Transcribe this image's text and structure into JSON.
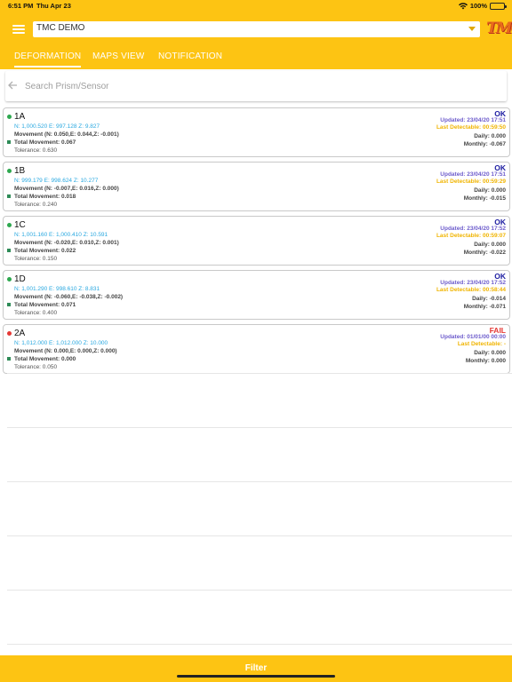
{
  "statusbar": {
    "time": "6:51 PM",
    "date": "Thu Apr 23",
    "battery": "100%"
  },
  "project": {
    "selected": "TMC DEMO"
  },
  "logo_text": "TMC",
  "tabs": [
    "DEFORMATION",
    "MAPS VIEW",
    "NOTIFICATION"
  ],
  "search": {
    "placeholder": "Search Prism/Sensor"
  },
  "items": [
    {
      "name": "1A",
      "coords": "N: 1,000.520 E: 997.128 Z: 9.827",
      "movement": "Movement (N: 0.050,E: 0.044,Z: -0.001)",
      "total": "Total Movement: 0.067",
      "tolerance": "Tolerance: 0.630",
      "status": "OK",
      "updated": "Updated: 23/04/20 17:51",
      "last_detectable": "Last Detectable: 00:59:50",
      "daily": "Daily: 0.000",
      "monthly": "Monthly: -0.067",
      "dot_color": "#2ea84f",
      "status_color": "#1a1aa0"
    },
    {
      "name": "1B",
      "coords": "N: 999.179 E: 998.624 Z: 10.277",
      "movement": "Movement (N: -0.007,E: 0.016,Z: 0.000)",
      "total": "Total Movement: 0.018",
      "tolerance": "Tolerance: 0.240",
      "status": "OK",
      "updated": "Updated: 23/04/20 17:51",
      "last_detectable": "Last Detectable: 00:59:29",
      "daily": "Daily: 0.000",
      "monthly": "Monthly: -0.015",
      "dot_color": "#2ea84f",
      "status_color": "#1a1aa0"
    },
    {
      "name": "1C",
      "coords": "N: 1,001.160 E: 1,000.410 Z: 10.591",
      "movement": "Movement (N: -0.020,E: 0.010,Z: 0.001)",
      "total": "Total Movement: 0.022",
      "tolerance": "Tolerance: 0.150",
      "status": "OK",
      "updated": "Updated: 23/04/20 17:52",
      "last_detectable": "Last Detectable: 00:59:07",
      "daily": "Daily: 0.000",
      "monthly": "Monthly: -0.022",
      "dot_color": "#2ea84f",
      "status_color": "#1a1aa0"
    },
    {
      "name": "1D",
      "coords": "N: 1,001.290 E: 998.610 Z: 8.831",
      "movement": "Movement (N: -0.060,E: -0.038,Z: -0.002)",
      "total": "Total Movement: 0.071",
      "tolerance": "Tolerance: 0.400",
      "status": "OK",
      "updated": "Updated: 23/04/20 17:52",
      "last_detectable": "Last Detectable: 00:58:44",
      "daily": "Daily: -0.014",
      "monthly": "Monthly: -0.071",
      "dot_color": "#2ea84f",
      "status_color": "#1a1aa0"
    },
    {
      "name": "2A",
      "coords": "N: 1,012.000 E: 1,012.000 Z: 10.000",
      "movement": "Movement (N: 0.000,E: 0.000,Z: 0.000)",
      "total": "Total Movement: 0.000",
      "tolerance": "Tolerance: 0.050",
      "status": "FAIL",
      "updated": "Updated: 01/01/00 00:00",
      "last_detectable": "Last Detectable: -",
      "daily": "Daily: 0.000",
      "monthly": "Monthly: 0.000",
      "dot_color": "#e53935",
      "status_color": "#e53935"
    }
  ],
  "filter": {
    "label": "Filter"
  },
  "colors": {
    "accent": "#fdc413",
    "ok": "#1a1aa0",
    "fail": "#e53935",
    "coords": "#29a8e0",
    "updated": "#6d5ccc",
    "last_detectable": "#f0b400"
  }
}
